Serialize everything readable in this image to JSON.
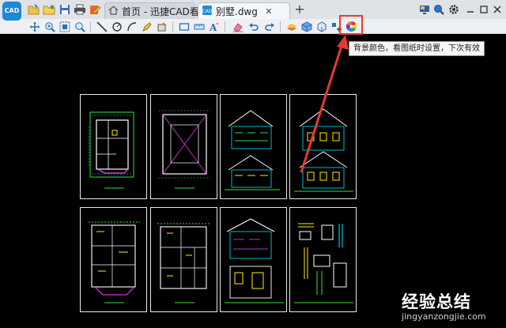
{
  "app": {
    "logo_text": "CAD"
  },
  "tabs": [
    {
      "label": "首页 - 迅捷CAD看图",
      "active": false
    },
    {
      "label": "别墅.dwg",
      "active": true
    }
  ],
  "tooltip": {
    "text": "背景颜色，看图纸时设置，下次有效"
  },
  "watermark": {
    "text": "经验总结",
    "url": "jingyanzongjie.com"
  },
  "colors": {
    "highlight": "#e53935",
    "arrow": "#e53935",
    "drawing_cyan": "#00e5ff",
    "drawing_green": "#35e03a",
    "drawing_yellow": "#ffee00",
    "drawing_magenta": "#ff40ff"
  },
  "icons": {
    "quick_access": [
      "open-folder-icon",
      "folder-icon",
      "save-icon",
      "print-icon",
      "home-edit-icon"
    ],
    "toolbar": [
      "pan-icon",
      "zoom-in-icon",
      "zoom-window-icon",
      "zoom-extents-icon",
      "line-icon",
      "circle-icon",
      "arc-icon",
      "pen-icon",
      "fill-icon",
      "rectangle-icon",
      "measure-icon",
      "text-icon",
      "eraser-icon",
      "undo-icon",
      "redo-icon",
      "layer-icon",
      "cube-icon",
      "3d-view-icon",
      "snap-icon",
      "background-color-icon"
    ],
    "window": [
      "monitor-icon",
      "zoom-icon",
      "settings-icon",
      "minimize-icon",
      "maximize-icon",
      "close-icon"
    ]
  }
}
